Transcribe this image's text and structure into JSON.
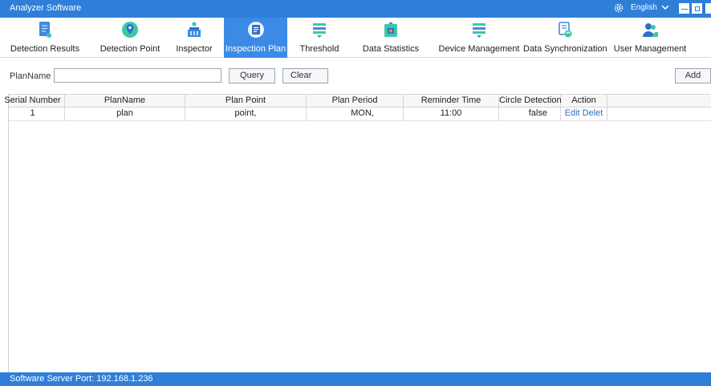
{
  "window": {
    "title": "Analyzer Software",
    "language": "English",
    "accent_color": "#2f7fd9",
    "active_tab_color": "#3b8be6"
  },
  "nav": {
    "items": [
      {
        "label": "Detection Results",
        "icon": "document-icon",
        "active": false
      },
      {
        "label": "Detection Point",
        "icon": "map-pin-icon",
        "active": false
      },
      {
        "label": "Inspector",
        "icon": "inspector-icon",
        "active": false
      },
      {
        "label": "Inspection Plan",
        "icon": "clipboard-icon",
        "active": true
      },
      {
        "label": "Threshold",
        "icon": "threshold-icon",
        "active": false
      },
      {
        "label": "Data Statistics",
        "icon": "statistics-icon",
        "active": false
      },
      {
        "label": "Device Management",
        "icon": "device-icon",
        "active": false
      },
      {
        "label": "Data Synchronization",
        "icon": "sync-icon",
        "active": false
      },
      {
        "label": "User Management",
        "icon": "users-icon",
        "active": false
      }
    ]
  },
  "search": {
    "label": "PlanName",
    "value": "",
    "query_label": "Query",
    "clear_label": "Clear",
    "add_label": "Add"
  },
  "table": {
    "columns": [
      "Serial Number",
      "PlanName",
      "Plan Point",
      "Plan Period",
      "Reminder Time",
      "Circle Detection",
      "Action"
    ],
    "rows": [
      {
        "serial": "1",
        "plan_name": "plan",
        "plan_point": "point,",
        "plan_period": "MON,",
        "reminder_time": "11:00",
        "circle_detection": "false",
        "edit_label": "Edit",
        "delete_label": "Delet"
      }
    ]
  },
  "status": {
    "text": "Software Server Port: 192.168.1.236"
  }
}
